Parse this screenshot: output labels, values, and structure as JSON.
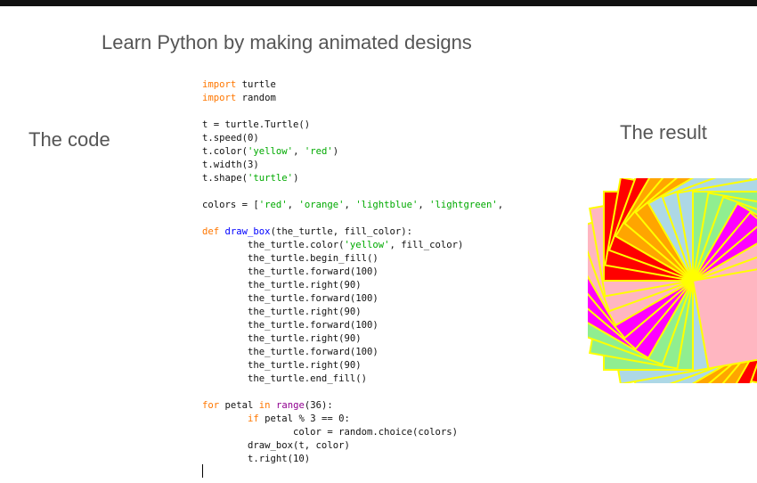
{
  "title": "Learn Python by making animated designs",
  "label_code": "The code",
  "label_result": "The result",
  "colors": {
    "keyword": "#ff7700",
    "string": "#00aa00",
    "def_name": "#0000ff",
    "builtin": "#900090",
    "plain": "#111111",
    "outline": "#ffff00"
  },
  "result_palette": [
    "#ff0000",
    "#ffa500",
    "#add8e6",
    "#90ee90",
    "#ff00ff",
    "#ffb6c1"
  ],
  "code_lines": [
    [
      {
        "t": "import",
        "k": "keyword"
      },
      {
        "t": " turtle",
        "k": "plain"
      }
    ],
    [
      {
        "t": "import",
        "k": "keyword"
      },
      {
        "t": " random",
        "k": "plain"
      }
    ],
    [],
    [
      {
        "t": "t = turtle.Turtle()",
        "k": "plain"
      }
    ],
    [
      {
        "t": "t.speed(0)",
        "k": "plain"
      }
    ],
    [
      {
        "t": "t.color(",
        "k": "plain"
      },
      {
        "t": "'yellow'",
        "k": "string"
      },
      {
        "t": ", ",
        "k": "plain"
      },
      {
        "t": "'red'",
        "k": "string"
      },
      {
        "t": ")",
        "k": "plain"
      }
    ],
    [
      {
        "t": "t.width(3)",
        "k": "plain"
      }
    ],
    [
      {
        "t": "t.shape(",
        "k": "plain"
      },
      {
        "t": "'turtle'",
        "k": "string"
      },
      {
        "t": ")",
        "k": "plain"
      }
    ],
    [],
    [
      {
        "t": "colors = [",
        "k": "plain"
      },
      {
        "t": "'red'",
        "k": "string"
      },
      {
        "t": ", ",
        "k": "plain"
      },
      {
        "t": "'orange'",
        "k": "string"
      },
      {
        "t": ", ",
        "k": "plain"
      },
      {
        "t": "'lightblue'",
        "k": "string"
      },
      {
        "t": ", ",
        "k": "plain"
      },
      {
        "t": "'lightgreen'",
        "k": "string"
      },
      {
        "t": ",",
        "k": "plain"
      }
    ],
    [],
    [
      {
        "t": "def",
        "k": "keyword"
      },
      {
        "t": " ",
        "k": "plain"
      },
      {
        "t": "draw_box",
        "k": "def"
      },
      {
        "t": "(the_turtle, fill_color):",
        "k": "plain"
      }
    ],
    [
      {
        "t": "        the_turtle.color(",
        "k": "plain"
      },
      {
        "t": "'yellow'",
        "k": "string"
      },
      {
        "t": ", fill_color)",
        "k": "plain"
      }
    ],
    [
      {
        "t": "        the_turtle.begin_fill()",
        "k": "plain"
      }
    ],
    [
      {
        "t": "        the_turtle.forward(100)",
        "k": "plain"
      }
    ],
    [
      {
        "t": "        the_turtle.right(90)",
        "k": "plain"
      }
    ],
    [
      {
        "t": "        the_turtle.forward(100)",
        "k": "plain"
      }
    ],
    [
      {
        "t": "        the_turtle.right(90)",
        "k": "plain"
      }
    ],
    [
      {
        "t": "        the_turtle.forward(100)",
        "k": "plain"
      }
    ],
    [
      {
        "t": "        the_turtle.right(90)",
        "k": "plain"
      }
    ],
    [
      {
        "t": "        the_turtle.forward(100)",
        "k": "plain"
      }
    ],
    [
      {
        "t": "        the_turtle.right(90)",
        "k": "plain"
      }
    ],
    [
      {
        "t": "        the_turtle.end_fill()",
        "k": "plain"
      }
    ],
    [],
    [
      {
        "t": "for",
        "k": "keyword"
      },
      {
        "t": " petal ",
        "k": "plain"
      },
      {
        "t": "in",
        "k": "keyword"
      },
      {
        "t": " ",
        "k": "plain"
      },
      {
        "t": "range",
        "k": "builtin"
      },
      {
        "t": "(36):",
        "k": "plain"
      }
    ],
    [
      {
        "t": "        ",
        "k": "plain"
      },
      {
        "t": "if",
        "k": "keyword"
      },
      {
        "t": " petal % 3 == 0:",
        "k": "plain"
      }
    ],
    [
      {
        "t": "                color = random.choice(colors)",
        "k": "plain"
      }
    ],
    [
      {
        "t": "        draw_box(t, color)",
        "k": "plain"
      }
    ],
    [
      {
        "t": "        t.right(10)",
        "k": "plain"
      }
    ]
  ]
}
